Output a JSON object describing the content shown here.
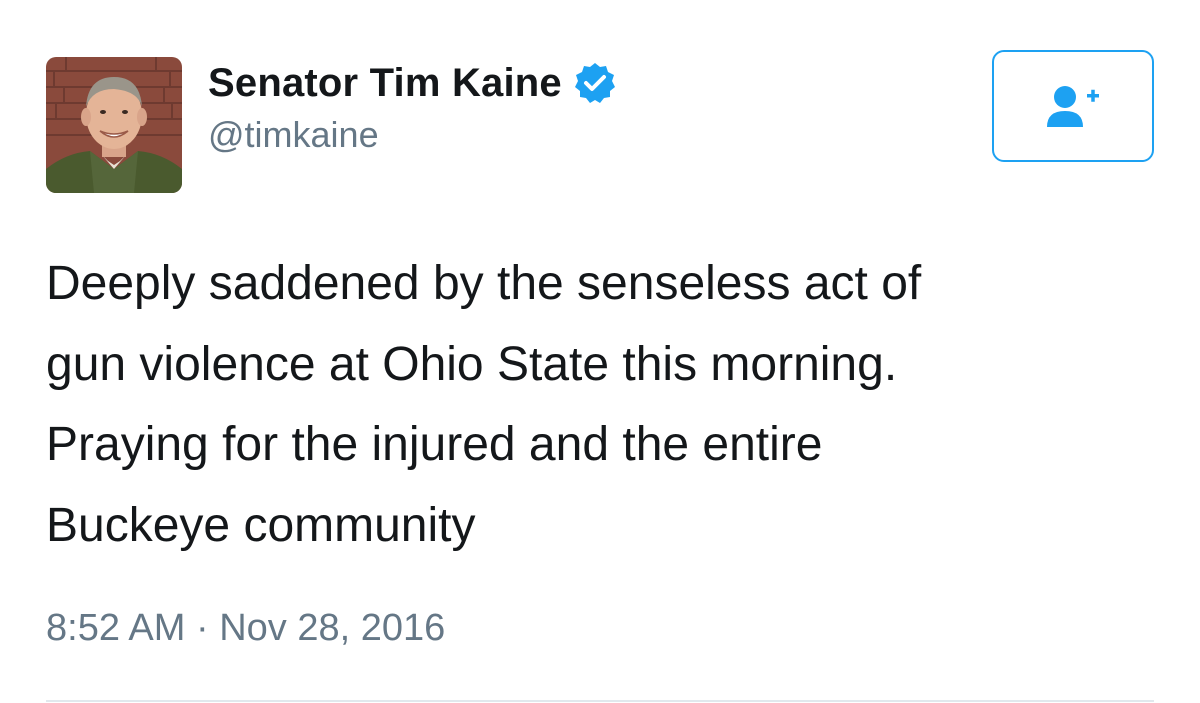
{
  "author": {
    "display_name": "Senator Tim Kaine",
    "username": "@timkaine",
    "verified": true
  },
  "follow_button": {
    "icon": "add-user-icon"
  },
  "tweet": {
    "lines": [
      "Deeply saddened by the senseless act of",
      "gun violence at Ohio State this morning.",
      "Praying for the injured and the entire",
      "Buckeye community"
    ],
    "time": "8:52 AM",
    "separator": "·",
    "date": "Nov 28, 2016"
  },
  "colors": {
    "accent": "#1da1f2",
    "text": "#14171a",
    "secondary": "#657786",
    "divider": "#e1e8ed"
  }
}
